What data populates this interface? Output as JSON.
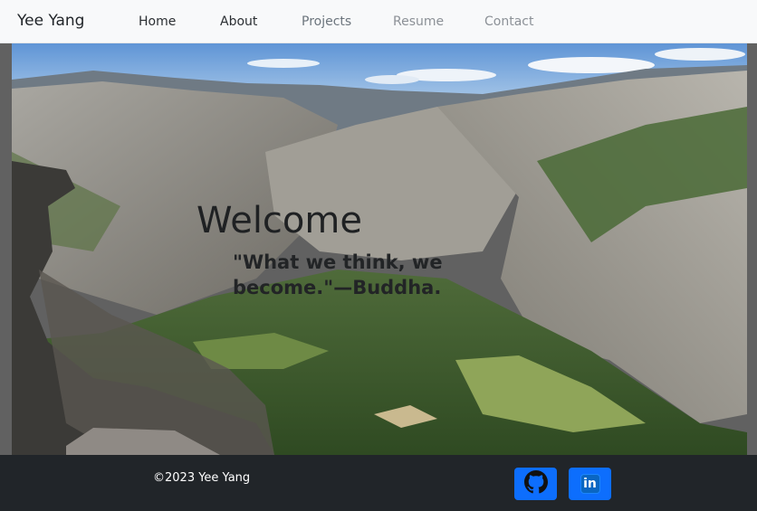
{
  "navbar": {
    "brand": "Yee Yang",
    "links": [
      {
        "label": "Home"
      },
      {
        "label": "About"
      },
      {
        "label": "Projects"
      },
      {
        "label": "Resume"
      },
      {
        "label": "Contact"
      }
    ]
  },
  "hero": {
    "heading": "Welcome",
    "quote": "\"What we think, we become.\"—Buddha."
  },
  "footer": {
    "copyright": "©2023 Yee Yang",
    "social": [
      {
        "name": "GitHub",
        "icon": "github-icon"
      },
      {
        "name": "LinkedIn",
        "icon": "linkedin-icon",
        "glyph": "in"
      }
    ]
  },
  "colors": {
    "navbar_bg": "#f8f9fa",
    "footer_bg": "#212529",
    "button_blue": "#0d6efd",
    "sky": "#7fb2e4",
    "forest": "#3f5f2f"
  }
}
